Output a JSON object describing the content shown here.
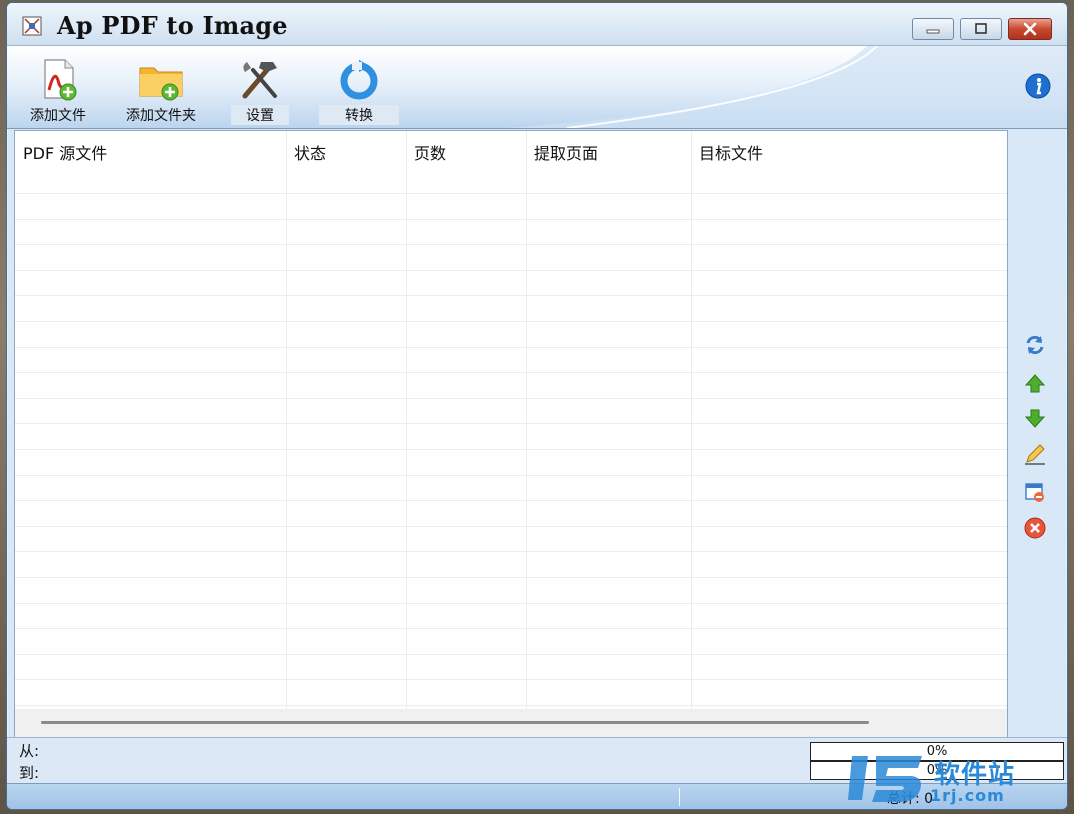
{
  "window": {
    "title": "Ap PDF to Image"
  },
  "toolbar": {
    "buttons": [
      {
        "label": "添加文件",
        "icon": "add-file-icon"
      },
      {
        "label": "添加文件夹",
        "icon": "add-folder-icon"
      },
      {
        "label": "设置",
        "icon": "settings-tools-icon"
      },
      {
        "label": "转换",
        "icon": "convert-icon"
      }
    ],
    "info_icon": "info-icon"
  },
  "table": {
    "columns": [
      "PDF 源文件",
      "状态",
      "页数",
      "提取页面",
      "目标文件"
    ],
    "rows": []
  },
  "side_actions": [
    {
      "icon": "refresh-icon"
    },
    {
      "icon": "move-up-icon"
    },
    {
      "icon": "move-down-icon"
    },
    {
      "icon": "edit-icon"
    },
    {
      "icon": "remove-item-icon"
    },
    {
      "icon": "clear-all-icon"
    }
  ],
  "status": {
    "from_label": "从:",
    "to_label": "到:",
    "progress1": "0%",
    "progress2": "0%",
    "progress1_value": 0,
    "progress2_value": 0,
    "total": "总计: 0"
  },
  "watermark": {
    "text": "软件站",
    "sub": "1rj.com"
  }
}
